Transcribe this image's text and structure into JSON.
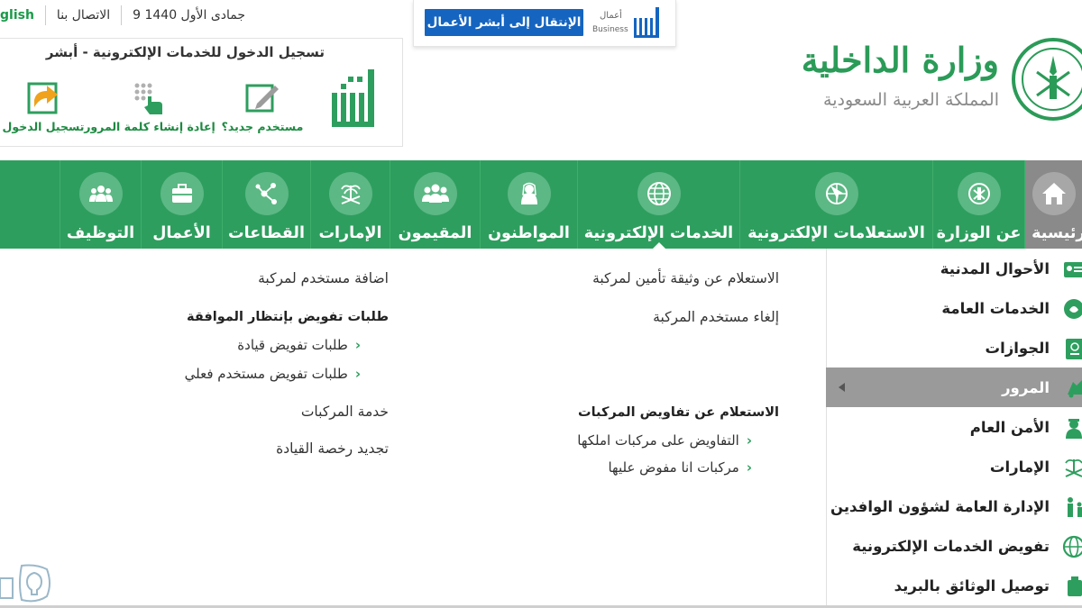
{
  "top_bar": {
    "language": "glish",
    "contact": "الاتصال بنا",
    "date": "9 جمادى الأول 1440"
  },
  "business": {
    "button_label": "الإنتقال إلى أبشر الأعمال",
    "logo_ar": "أعمال",
    "logo_en": "Business"
  },
  "absher": {
    "title": "تسجيل الدخول للخدمات الإلكترونية - أبشر",
    "actions": [
      {
        "label": "مستخدم جديد؟",
        "icon": "edit-icon"
      },
      {
        "label": "إعادة إنشاء كلمة المرور",
        "icon": "touch-keypad-icon"
      },
      {
        "label": "تسجيل الدخول",
        "icon": "login-arrow-icon"
      }
    ]
  },
  "ministry": {
    "name": "وزارة الداخلية",
    "country": "المملكة العربية السعودية"
  },
  "nav": {
    "items": [
      {
        "label": "الرئيسية",
        "icon": "home-icon"
      },
      {
        "label": "عن الوزارة",
        "icon": "emblem-icon"
      },
      {
        "label": "الاستعلامات الإلكترونية",
        "icon": "globe-cursor-icon"
      },
      {
        "label": "الخدمات الإلكترونية",
        "icon": "globe-icon"
      },
      {
        "label": "المواطنون",
        "icon": "citizen-icon"
      },
      {
        "label": "المقيمون",
        "icon": "group-icon"
      },
      {
        "label": "الإمارات",
        "icon": "palm-swords-icon"
      },
      {
        "label": "القطاعات",
        "icon": "network-icon"
      },
      {
        "label": "الأعمال",
        "icon": "briefcase-icon"
      },
      {
        "label": "التوظيف",
        "icon": "people-icon"
      }
    ]
  },
  "sidebar": {
    "items": [
      {
        "label": "الأحوال المدنية"
      },
      {
        "label": "الخدمات العامة"
      },
      {
        "label": "الجوازات"
      },
      {
        "label": "المرور",
        "active": true
      },
      {
        "label": "الأمن العام"
      },
      {
        "label": "الإمارات"
      },
      {
        "label": "الإدارة العامة لشؤون الوافدين"
      },
      {
        "label": "تفويض الخدمات الإلكترونية"
      },
      {
        "label": "توصيل الوثائق بالبريد"
      }
    ]
  },
  "content": {
    "col_right": {
      "link1": "الاستعلام عن وثيقة تأمين لمركبة",
      "link2": "إلغاء مستخدم المركبة",
      "group_title": "الاستعلام عن تفاويض المركبات",
      "sub1": "التفاويض على مركبات املكها",
      "sub2": "مركبات انا مفوض عليها"
    },
    "col_left": {
      "link1": "اضافة مستخدم لمركبة",
      "group_title": "طلبات تفويض بإنتظار الموافقة",
      "sub1": "طلبات تفويض قيادة",
      "sub2": "طلبات تفويض مستخدم فعلي",
      "link2": "خدمة المركبات",
      "link3": "تجديد رخصة القيادة"
    }
  },
  "colors": {
    "nav_green": "#2e9e5e",
    "brand_green": "#2b9b58",
    "business_blue": "#1565c0",
    "active_gray": "#9a9a9a"
  }
}
